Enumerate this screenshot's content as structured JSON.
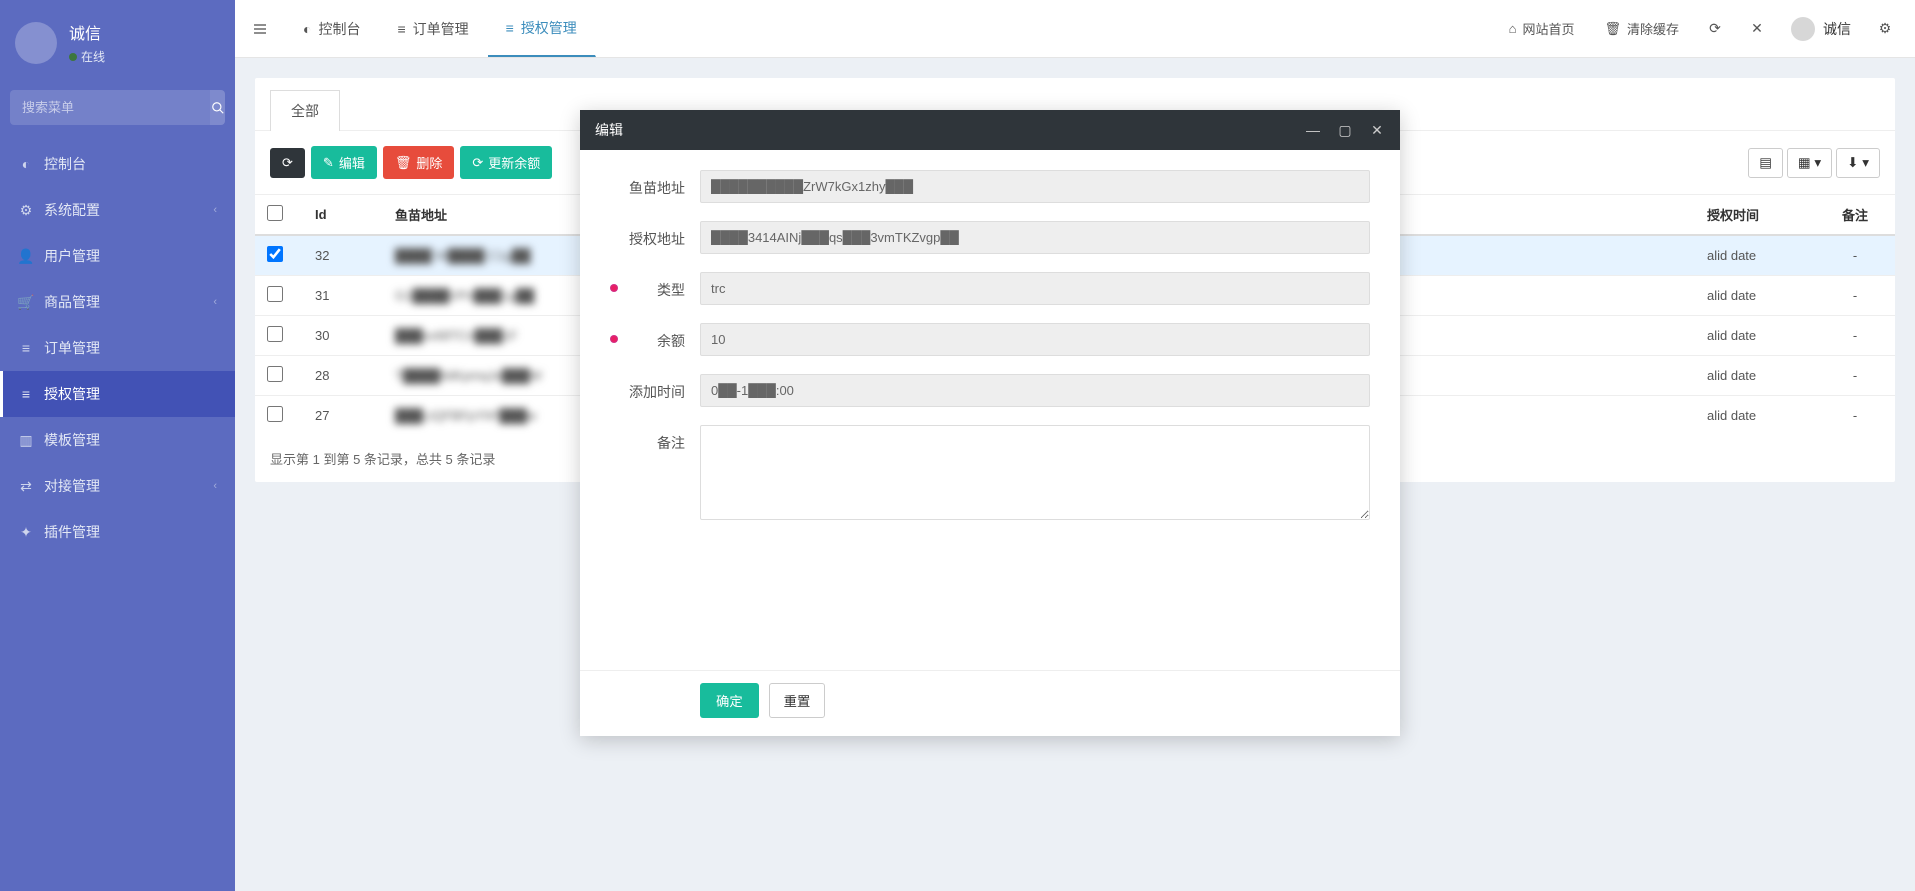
{
  "sidebar": {
    "user_name": "诚信",
    "user_status": "在线",
    "search_placeholder": "搜索菜单",
    "menu": [
      {
        "icon": "dashboard",
        "label": "控制台",
        "expandable": false
      },
      {
        "icon": "cog",
        "label": "系统配置",
        "expandable": true
      },
      {
        "icon": "user",
        "label": "用户管理",
        "expandable": false
      },
      {
        "icon": "cart",
        "label": "商品管理",
        "expandable": true
      },
      {
        "icon": "list",
        "label": "订单管理",
        "expandable": false
      },
      {
        "icon": "list",
        "label": "授权管理",
        "expandable": false,
        "active": true
      },
      {
        "icon": "folder",
        "label": "模板管理",
        "expandable": false
      },
      {
        "icon": "exchange",
        "label": "对接管理",
        "expandable": true
      },
      {
        "icon": "plug",
        "label": "插件管理",
        "expandable": false
      }
    ]
  },
  "topbar": {
    "tabs": [
      {
        "icon": "dashboard",
        "label": "控制台"
      },
      {
        "icon": "list",
        "label": "订单管理"
      },
      {
        "icon": "list",
        "label": "授权管理",
        "active": true
      }
    ],
    "home": "网站首页",
    "clear_cache": "清除缓存",
    "user_name": "诚信"
  },
  "content": {
    "inner_tab": "全部",
    "toolbar": {
      "edit": "编辑",
      "delete": "删除",
      "update_balance": "更新余额"
    },
    "columns": {
      "id": "Id",
      "addr": "鱼苗地址",
      "auth_time": "授权时间",
      "note": "备注"
    },
    "rows": [
      {
        "checked": true,
        "id": "32",
        "addr": "████ W████ C1g██",
        "auth_time": "alid date",
        "note": "-"
      },
      {
        "checked": false,
        "id": "31",
        "addr": "G1████VPn███1g██",
        "auth_time": "alid date",
        "note": "-"
      },
      {
        "checked": false,
        "id": "30",
        "addr": "███sv68TCn███1F",
        "auth_time": "alid date",
        "note": "-"
      },
      {
        "checked": false,
        "id": "28",
        "addr": "T████9dKpmqJe███W",
        "auth_time": "alid date",
        "note": "-"
      },
      {
        "checked": false,
        "id": "27",
        "addr": "███LtQFBFpYhF███w",
        "auth_time": "alid date",
        "note": "-"
      }
    ],
    "footer": "显示第 1 到第 5 条记录，总共 5 条记录"
  },
  "modal": {
    "title": "编辑",
    "fields": {
      "fish_addr": {
        "label": "鱼苗地址",
        "value": "██████████ZrW7kGx1zhy███"
      },
      "auth_addr": {
        "label": "授权地址",
        "value": "████3414AINj███qs███3vmTKZvgp██"
      },
      "type": {
        "label": "类型",
        "value": "trc",
        "required": true
      },
      "balance": {
        "label": "余额",
        "value": "10",
        "required": true
      },
      "add_time": {
        "label": "添加时间",
        "value": "0██-1███:00"
      },
      "note": {
        "label": "备注",
        "value": ""
      }
    },
    "btn_ok": "确定",
    "btn_reset": "重置"
  }
}
